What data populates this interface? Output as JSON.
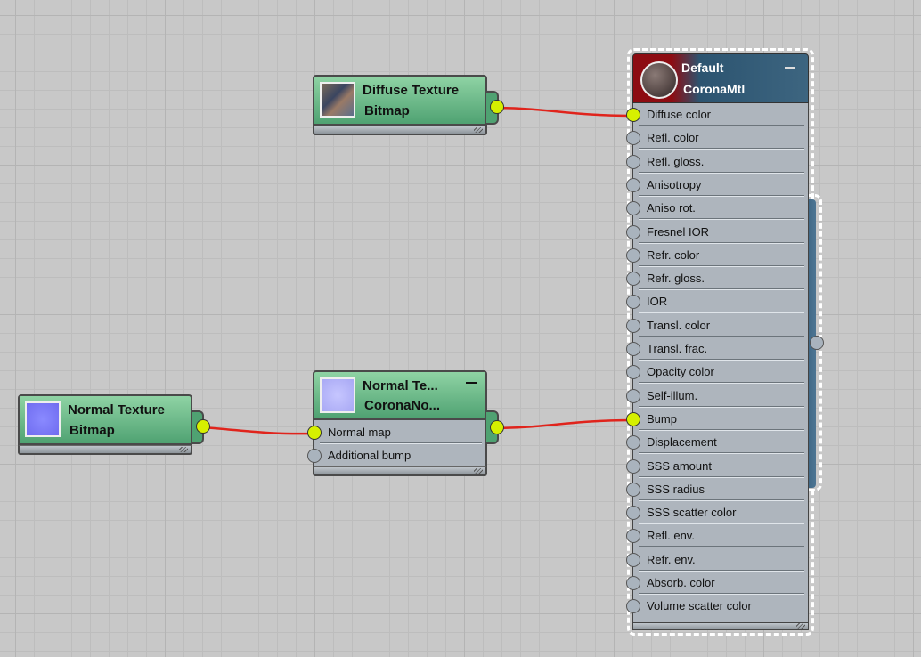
{
  "nodes": {
    "diffuse_bitmap": {
      "name": "Diffuse Texture",
      "type": "Bitmap"
    },
    "normal_bitmap": {
      "name": "Normal Texture",
      "type": "Bitmap"
    },
    "corona_normal": {
      "name": "Normal Te...",
      "type": "CoronaNo...",
      "slots": [
        "Normal map",
        "Additional bump"
      ]
    },
    "corona_mtl": {
      "name": "Default",
      "type": "CoronaMtl",
      "slots": [
        "Diffuse color",
        "Refl. color",
        "Refl. gloss.",
        "Anisotropy",
        "Aniso rot.",
        "Fresnel IOR",
        "Refr. color",
        "Refr. gloss.",
        "IOR",
        "Transl. color",
        "Transl. frac.",
        "Opacity color",
        "Self-illum.",
        "Bump",
        "Displacement",
        "SSS amount",
        "SSS radius",
        "SSS scatter color",
        "Refl. env.",
        "Refr. env.",
        "Absorb. color",
        "Volume scatter color"
      ],
      "connected_slots": [
        "Diffuse color",
        "Bump"
      ]
    }
  },
  "colors": {
    "wire": "#e0241c",
    "port_connected": "#d6f000",
    "port_empty": "#a9b3bd",
    "node_header_green": "#5aae7c",
    "material_header_red": "#8d0c12",
    "material_header_blue": "#2c5470"
  },
  "icons": {
    "diffuse_thumbnail": "diffuse-texture-thumbnail",
    "normal_thumbnail": "normal-map-thumbnail",
    "material_preview": "material-sphere-preview",
    "collapse": "minimize-icon"
  }
}
